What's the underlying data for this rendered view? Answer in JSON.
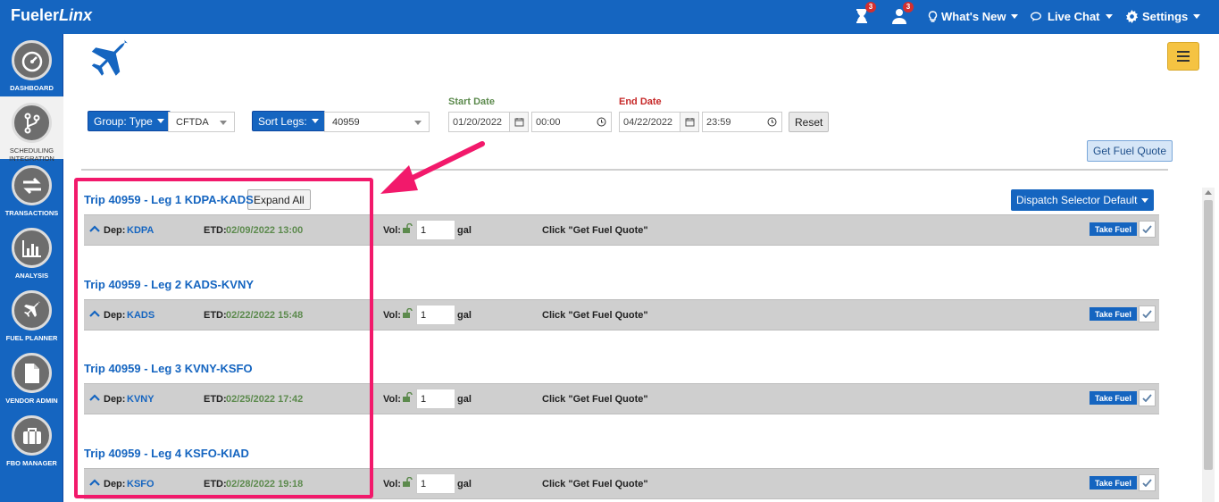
{
  "brand": {
    "name": "Fueler",
    "name_italic": "Linx"
  },
  "topnav": {
    "hourglass_badge": "3",
    "user_badge": "3",
    "whats_new": "What's New",
    "live_chat": "Live Chat",
    "settings": "Settings"
  },
  "sidebar": {
    "items": [
      {
        "label": "DASHBOARD",
        "icon": "dashboard-icon"
      },
      {
        "label": "SCHEDULING INTEGRATION",
        "icon": "branch-icon"
      },
      {
        "label": "TRANSACTIONS",
        "icon": "swap-icon"
      },
      {
        "label": "ANALYSIS",
        "icon": "bar-chart-icon"
      },
      {
        "label": "FUEL PLANNER",
        "icon": "plane-icon"
      },
      {
        "label": "VENDOR ADMIN",
        "icon": "document-icon"
      },
      {
        "label": "FBO MANAGER",
        "icon": "briefcase-icon"
      }
    ]
  },
  "filters": {
    "group_type_label": "Group: Type",
    "group_type_value": "CFTDA",
    "sort_legs_label": "Sort Legs:",
    "sort_legs_value": "40959",
    "start_date_label": "Start Date",
    "start_date": "01/20/2022",
    "start_time": "00:00",
    "end_date_label": "End Date",
    "end_date": "04/22/2022",
    "end_time": "23:59",
    "reset": "Reset",
    "get_fuel_quote": "Get Fuel Quote"
  },
  "colors": {
    "start_label": "#5c8a4d",
    "end_label": "#c62828",
    "accent": "#1565c0",
    "highlight": "#f2196b"
  },
  "actions": {
    "expand_all": "Expand All",
    "dispatch_selector": "Dispatch Selector Default"
  },
  "legs": [
    {
      "title": "Trip 40959 - Leg 1 KDPA-KADS",
      "dep": "KDPA",
      "etd": "02/09/2022 13:00",
      "vol": "1"
    },
    {
      "title": "Trip 40959 - Leg 2 KADS-KVNY",
      "dep": "KADS",
      "etd": "02/22/2022 15:48",
      "vol": "1"
    },
    {
      "title": "Trip 40959 - Leg 3 KVNY-KSFO",
      "dep": "KVNY",
      "etd": "02/25/2022 17:42",
      "vol": "1"
    },
    {
      "title": "Trip 40959 - Leg 4 KSFO-KIAD",
      "dep": "KSFO",
      "etd": "02/28/2022 19:18",
      "vol": "1"
    }
  ],
  "leg_labels": {
    "dep": "Dep:",
    "etd": "ETD:",
    "vol": "Vol:",
    "gal": "gal",
    "quote_msg": "Click \"Get Fuel Quote\"",
    "take_fuel": "Take Fuel"
  }
}
